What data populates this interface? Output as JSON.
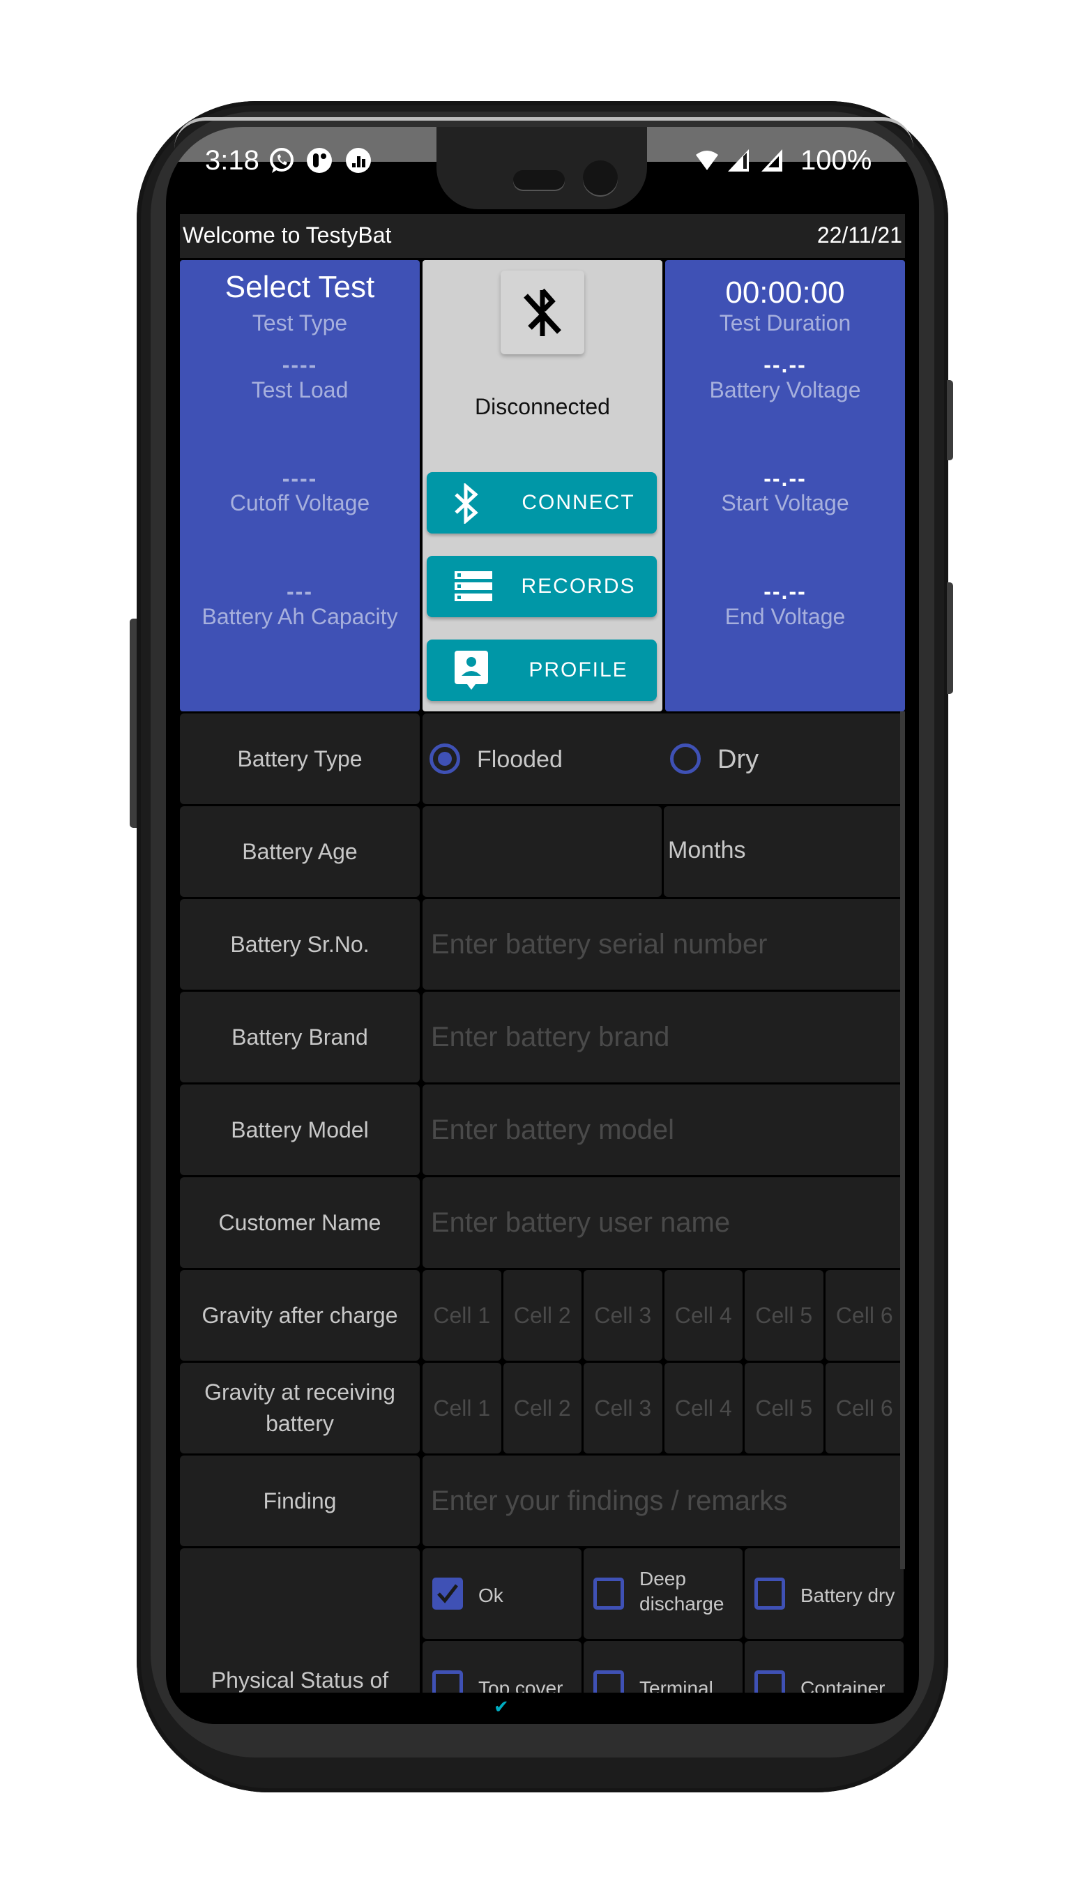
{
  "status_bar": {
    "time": "3:18",
    "left_icons": [
      "whatsapp-icon",
      "notification-app-icon",
      "stats-app-icon"
    ],
    "right_icons": [
      "wifi-icon",
      "signal-icon",
      "signal-icon-2"
    ],
    "battery": "100%"
  },
  "header": {
    "title": "Welcome to TestyBat",
    "date": "22/11/21"
  },
  "left_panel": {
    "title": "Select Test",
    "subtitle": "Test Type",
    "fields": [
      {
        "value": "----",
        "label": "Test Load"
      },
      {
        "value": "----",
        "label": "Cutoff Voltage"
      },
      {
        "value": "---",
        "label": "Battery Ah Capacity"
      }
    ]
  },
  "center_panel": {
    "bluetooth_icon": "bluetooth-disabled-icon",
    "status": "Disconnected",
    "buttons": [
      {
        "label": "CONNECT",
        "icon": "bluetooth-icon"
      },
      {
        "label": "RECORDS",
        "icon": "records-list-icon"
      },
      {
        "label": "PROFILE",
        "icon": "profile-icon"
      }
    ]
  },
  "right_panel": {
    "title": "00:00:00",
    "subtitle": "Test Duration",
    "fields": [
      {
        "value": "--.--",
        "label": "Battery Voltage"
      },
      {
        "value": "--.--",
        "label": "Start Voltage"
      },
      {
        "value": "--.--",
        "label": "End Voltage"
      }
    ]
  },
  "colors": {
    "primary": "#3f51b5",
    "accent": "#0097a7",
    "row_bg": "#1f1f1f"
  },
  "form": {
    "battery_type": {
      "label": "Battery Type",
      "options": [
        {
          "label": "Flooded",
          "selected": true
        },
        {
          "label": "Dry",
          "selected": false
        }
      ]
    },
    "battery_age": {
      "label": "Battery Age",
      "value": "",
      "unit": "Months"
    },
    "serial": {
      "label": "Battery Sr.No.",
      "placeholder": "Enter battery serial number",
      "value": ""
    },
    "brand": {
      "label": "Battery Brand",
      "placeholder": "Enter battery brand",
      "value": ""
    },
    "model": {
      "label": "Battery Model",
      "placeholder": "Enter battery model",
      "value": ""
    },
    "customer": {
      "label": "Customer Name",
      "placeholder": "Enter battery user name",
      "value": ""
    },
    "gravity_after": {
      "label": "Gravity after charge",
      "cells": [
        "Cell 1",
        "Cell 2",
        "Cell 3",
        "Cell 4",
        "Cell 5",
        "Cell 6"
      ]
    },
    "gravity_receiving": {
      "label": "Gravity at receiving battery",
      "cells": [
        "Cell 1",
        "Cell 2",
        "Cell 3",
        "Cell 4",
        "Cell 5",
        "Cell 6"
      ]
    },
    "finding": {
      "label": "Finding",
      "placeholder": "Enter your findings / remarks",
      "value": ""
    },
    "physical_status": {
      "label": "Physical Status of",
      "options": [
        {
          "label": "Ok",
          "checked": true
        },
        {
          "label": "Deep discharge",
          "checked": false
        },
        {
          "label": "Battery dry",
          "checked": false
        },
        {
          "label": "Top cover",
          "checked": false
        },
        {
          "label": "Terminal",
          "checked": false
        },
        {
          "label": "Container",
          "checked": false
        }
      ]
    }
  }
}
